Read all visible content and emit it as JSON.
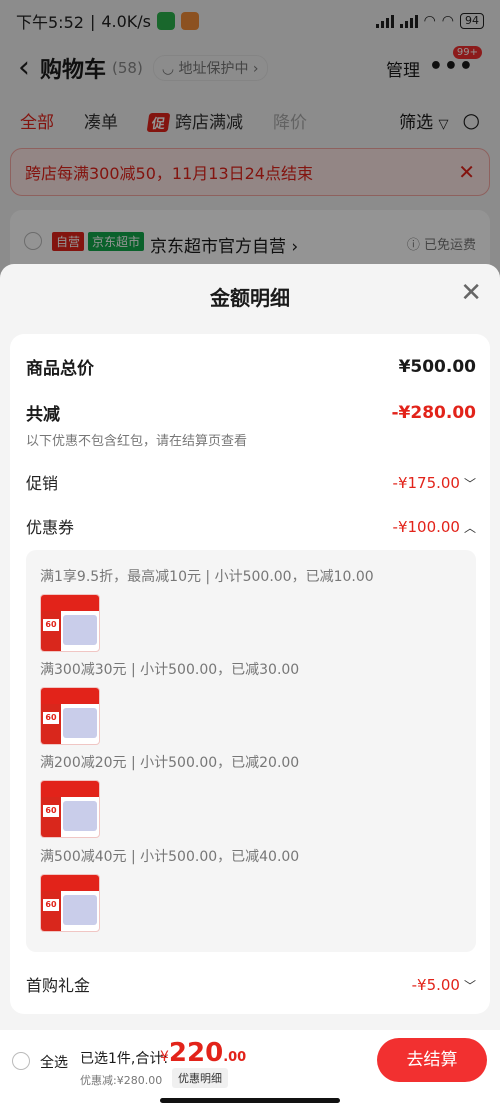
{
  "status": {
    "time": "下午5:52",
    "speed": "4.0K/s",
    "battery": "94"
  },
  "header": {
    "back": "‹",
    "title": "购物车",
    "count": "(58)",
    "address": "地址保护中 ›",
    "manage": "管理",
    "more": "•••",
    "badge": "99+"
  },
  "tabs": [
    {
      "label": "全部"
    },
    {
      "label": "凑单"
    },
    {
      "label": "跨店满减",
      "tag": "促"
    },
    {
      "label": "降价"
    }
  ],
  "filter_label": "筛选",
  "banner": {
    "text": "跨店每满300减50，11月13日24点结束",
    "close": "✕"
  },
  "store": {
    "tag_self": "自营",
    "tag_market": "京东超市",
    "name": "京东超市官方自营 ›",
    "shipping": "ⓘ 已免运费"
  },
  "sheet": {
    "title": "金额明细",
    "close": "✕",
    "total": {
      "label": "商品总价",
      "amount": "¥500.00"
    },
    "reduce": {
      "label": "共减",
      "amount": "-¥280.00",
      "note": "以下优惠不包含红包，请在结算页查看"
    },
    "promo": {
      "label": "促销",
      "amount": "-¥175.00",
      "chevron": "﹀"
    },
    "coupon": {
      "label": "优惠券",
      "amount": "-¥100.00",
      "chevron": "︿"
    },
    "coupon_items": [
      {
        "text": "满1享9.5折，最高减10元 | 小计500.00，已减10.00"
      },
      {
        "text": "满300减30元 | 小计500.00，已减30.00"
      },
      {
        "text": "满200减20元 | 小计500.00，已减20.00"
      },
      {
        "text": "满500减40元 | 小计500.00，已减40.00"
      }
    ],
    "gift": {
      "label": "首购礼金",
      "amount": "-¥5.00",
      "chevron": "﹀"
    }
  },
  "bottom": {
    "select_all": "全选",
    "selected": "已选1件,合计:",
    "currency": "¥",
    "total_int": "220",
    "total_dec": ".00",
    "discount": "优惠减:¥280.00",
    "detail": "优惠明细",
    "checkout": "去结算"
  },
  "colors": {
    "accent": "#e2231a",
    "checkout": "#f23030"
  },
  "icons": [
    "back-arrow-icon",
    "shield-icon",
    "more-icon",
    "filter-icon",
    "search-icon",
    "close-icon",
    "info-icon"
  ]
}
